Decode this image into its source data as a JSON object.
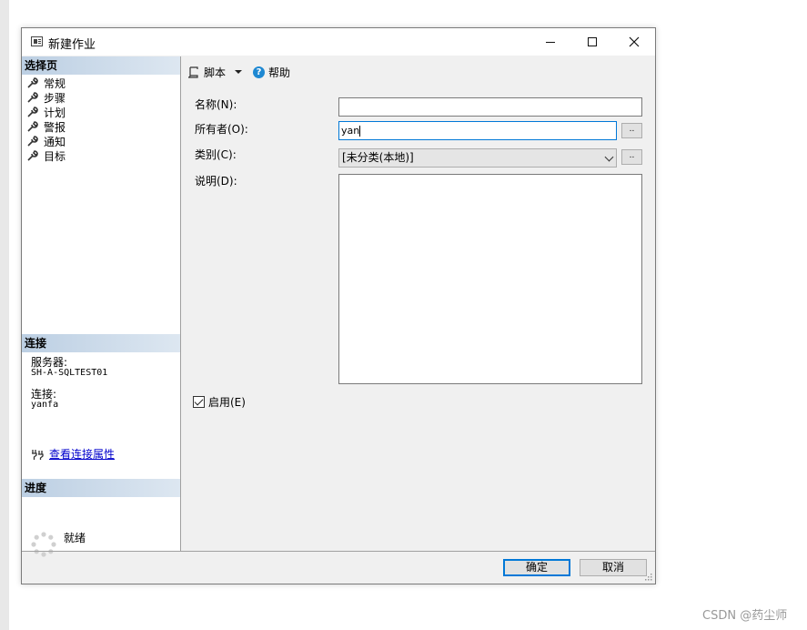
{
  "window": {
    "title": "新建作业"
  },
  "left": {
    "select_header": "选择页",
    "pages": [
      "常规",
      "步骤",
      "计划",
      "警报",
      "通知",
      "目标"
    ],
    "connection_header": "连接",
    "server_label": "服务器:",
    "server_value": "SH-A-SQLTEST01",
    "connection_label": "连接:",
    "connection_value": "yanfa",
    "view_props_link": "查看连接属性",
    "progress_header": "进度",
    "progress_status": "就绪"
  },
  "toolbar": {
    "script_label": "脚本",
    "help_label": "帮助"
  },
  "form": {
    "name_label": "名称(N):",
    "name_value": "",
    "owner_label": "所有者(O):",
    "owner_value": "yan",
    "ellipsis": "..",
    "category_label": "类别(C):",
    "category_value": "[未分类(本地)]",
    "description_label": "说明(D):",
    "description_value": "",
    "enabled_label": "启用(E)",
    "enabled": true
  },
  "buttons": {
    "ok": "确定",
    "cancel": "取消"
  },
  "watermark": "CSDN @药尘师"
}
